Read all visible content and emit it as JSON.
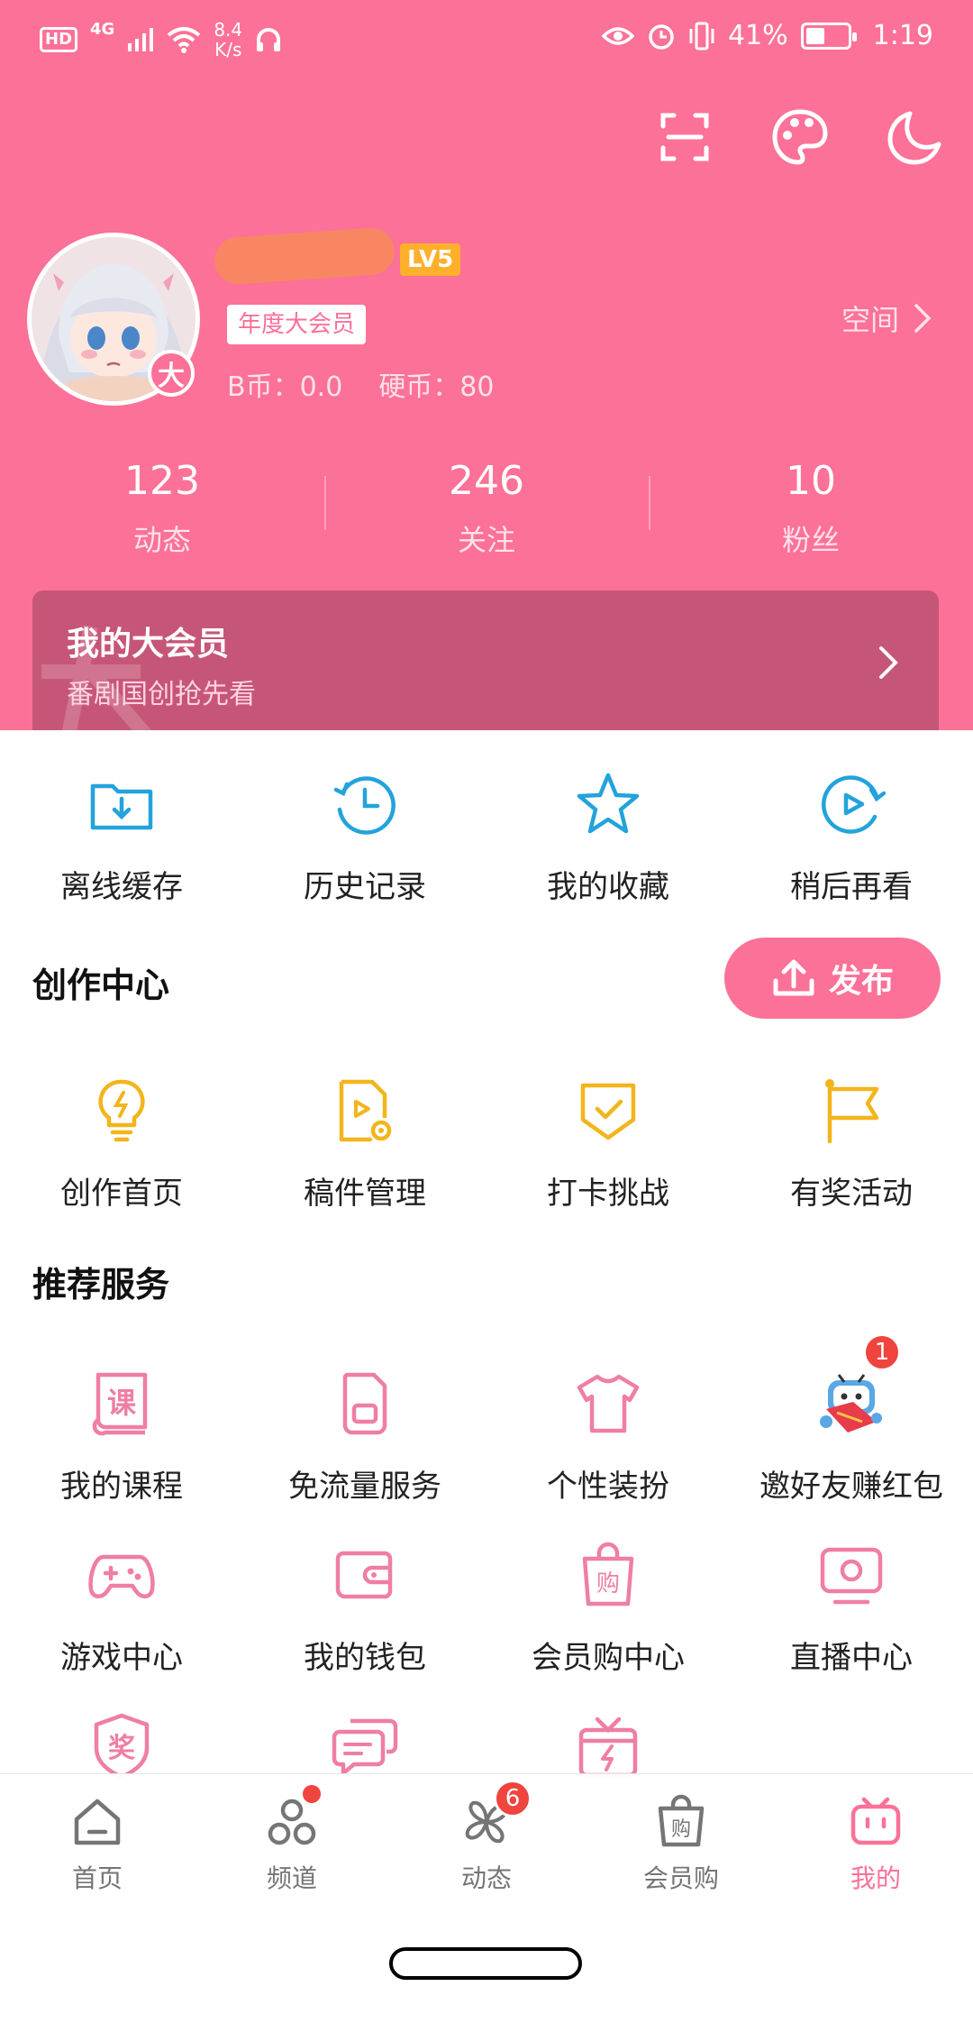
{
  "status_bar": {
    "hd": "HD",
    "network": "4G",
    "speed_value": "8.4",
    "speed_unit": "K/s",
    "battery": "41%",
    "time": "1:19"
  },
  "profile": {
    "level": "LV5",
    "vip_label": "年度大会员",
    "b_coins": "B币：0.0",
    "coins": "硬币：80",
    "space_link": "空间",
    "avatar_badge": "大"
  },
  "stats": [
    {
      "value": "123",
      "label": "动态"
    },
    {
      "value": "246",
      "label": "关注"
    },
    {
      "value": "10",
      "label": "粉丝"
    }
  ],
  "vip_card": {
    "title": "我的大会员",
    "subtitle": "番剧国创抢先看"
  },
  "quick_actions": [
    {
      "label": "离线缓存",
      "icon": "offline-cache-icon"
    },
    {
      "label": "历史记录",
      "icon": "history-icon"
    },
    {
      "label": "我的收藏",
      "icon": "star-icon"
    },
    {
      "label": "稍后再看",
      "icon": "watch-later-icon"
    }
  ],
  "creation": {
    "title": "创作中心",
    "publish_label": "发布",
    "items": [
      {
        "label": "创作首页",
        "icon": "lightbulb-icon"
      },
      {
        "label": "稿件管理",
        "icon": "manuscript-icon"
      },
      {
        "label": "打卡挑战",
        "icon": "checkin-shield-icon"
      },
      {
        "label": "有奖活动",
        "icon": "flag-icon"
      }
    ]
  },
  "services": {
    "title": "推荐服务",
    "row1": [
      {
        "label": "我的课程",
        "icon": "course-book-icon"
      },
      {
        "label": "免流量服务",
        "icon": "sim-card-icon"
      },
      {
        "label": "个性装扮",
        "icon": "tshirt-icon"
      },
      {
        "label": "邀好友赚红包",
        "icon": "red-packet-mascot-icon",
        "badge": "1"
      }
    ],
    "row2": [
      {
        "label": "游戏中心",
        "icon": "gamepad-icon"
      },
      {
        "label": "我的钱包",
        "icon": "wallet-icon"
      },
      {
        "label": "会员购中心",
        "icon": "shopping-bag-icon"
      },
      {
        "label": "直播中心",
        "icon": "live-tv-icon"
      }
    ],
    "row3_icons": [
      "award-shield-icon",
      "chat-bubbles-icon",
      "gift-box-icon"
    ],
    "course_glyph": "课",
    "award_glyph": "奖",
    "shop_glyph": "购"
  },
  "tabs": [
    {
      "label": "首页",
      "icon": "home-icon"
    },
    {
      "label": "频道",
      "icon": "channel-icon",
      "dot": true
    },
    {
      "label": "动态",
      "icon": "pinwheel-icon",
      "badge": "6"
    },
    {
      "label": "会员购",
      "icon": "shop-bag-icon"
    },
    {
      "label": "我的",
      "icon": "tv-mascot-icon",
      "active": true
    }
  ],
  "colors": {
    "brand_pink": "#fc7197",
    "blue_icon": "#23a3dc",
    "yellow_icon": "#f2b51b",
    "pink_icon": "#ef7ea5"
  }
}
